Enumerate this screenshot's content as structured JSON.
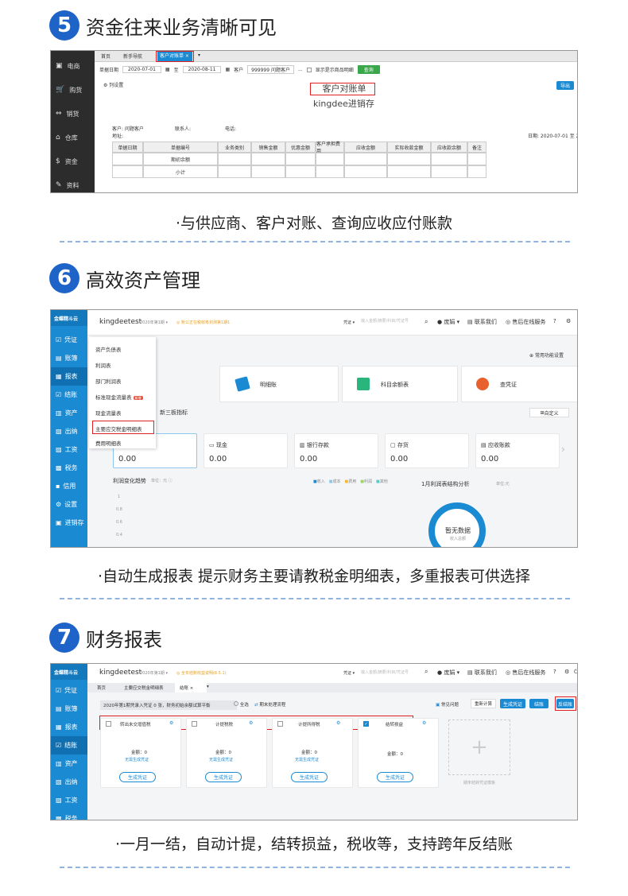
{
  "sections": [
    {
      "num": "5",
      "title": "资金往来业务清晰可见",
      "caption": "·与供应商、客户对账、查询应收应付账款"
    },
    {
      "num": "6",
      "title": "高效资产管理",
      "caption": "·自动生成报表 提示财务主要请教税金明细表，多重报表可供选择"
    },
    {
      "num": "7",
      "title": "财务报表",
      "caption": "·一月一结，自动计提，结转损益，税收等，支持跨年反结账"
    }
  ],
  "s1": {
    "sidebar": [
      {
        "icon": "▣",
        "label": "电商"
      },
      {
        "icon": "🛒",
        "label": "购货"
      },
      {
        "icon": "⇔",
        "label": "销货"
      },
      {
        "icon": "⌂",
        "label": "仓库"
      },
      {
        "icon": "$",
        "label": "资金"
      },
      {
        "icon": "✎",
        "label": "资料"
      }
    ],
    "tabs": [
      "首页",
      "新手导航",
      "客户对账单"
    ],
    "toolbar": {
      "date_label": "单据日期",
      "date_from": "2020-07-01",
      "to": "至",
      "date_to": "2020-08-11",
      "customer_label": "客户",
      "customer_value": "999999 问题客户",
      "more": "...",
      "checkbox_label": "显示是示商品明细",
      "query": "查询"
    },
    "settings": "列设置",
    "export": "导出",
    "report_title": "客户对账单",
    "report_sub": "kingdee进销存",
    "info": {
      "customer": "客户: 问题客户",
      "contact": "联系人:",
      "phone": "电话:",
      "address": "地址:",
      "date_range": "日期: 2020-07-01 至 2020"
    },
    "columns": [
      "单据日期",
      "单据编号",
      "业务类别",
      "销售金额",
      "优惠金额",
      "客户承担费用",
      "应收金额",
      "实际收款金额",
      "应收款余额",
      "备注"
    ],
    "rows": [
      "期初余额",
      "小计"
    ]
  },
  "s2": {
    "logo": "金蝶精斗云",
    "account": "kingdeetest",
    "period": "2020年第1期 ▾",
    "notice": "◎ 账公正在税收筹划测第1期1",
    "voucher": "凭证 ▾",
    "search_placeholder": "输入金额/摘要/科目/凭证号",
    "user": "庞娟 ▾",
    "contact": "联系我们",
    "service": "售后在线服务",
    "help": "?",
    "settings_icon": "⚙",
    "sidebar": [
      {
        "icon": "☑",
        "label": "凭证"
      },
      {
        "icon": "▤",
        "label": "账簿"
      },
      {
        "icon": "▦",
        "label": "报表"
      },
      {
        "icon": "☑",
        "label": "结账"
      },
      {
        "icon": "▥",
        "label": "资产"
      },
      {
        "icon": "▧",
        "label": "出纳"
      },
      {
        "icon": "▨",
        "label": "工资"
      },
      {
        "icon": "▩",
        "label": "税务"
      },
      {
        "icon": "▪",
        "label": "信用"
      },
      {
        "icon": "⚙",
        "label": "设置"
      },
      {
        "icon": "▣",
        "label": "进销存"
      }
    ],
    "menu": [
      "资产负债表",
      "利润表",
      "部门利润表",
      "标准现金流量表",
      "现金流量表",
      "主要应交税金明细表",
      "费用明细表"
    ],
    "menu_badge": "新增",
    "common": "常用功能设置",
    "shortcuts": [
      "明细账",
      "科目余额表",
      "查凭证"
    ],
    "tab_partial": "新三板指标",
    "customize": "自定义",
    "stats": [
      {
        "label": "",
        "value": "0.00"
      },
      {
        "label": "现金",
        "value": "0.00"
      },
      {
        "label": "银行存款",
        "value": "0.00"
      },
      {
        "label": "存货",
        "value": "0.00"
      },
      {
        "label": "应收账款",
        "value": "0.00"
      }
    ],
    "trend_title": "利润变化趋势",
    "trend_unit": "单位：元 ⓘ",
    "legend": [
      "收入",
      "成本",
      "费用",
      "利润",
      "其他"
    ],
    "y_ticks": [
      "1",
      "0.8",
      "0.6",
      "0.4"
    ],
    "struct_title": "1月利润表结构分析",
    "struct_unit": "单位:元",
    "no_data": "暂无数据",
    "no_data_sub": "收入总额",
    "colors": {
      "blue": "#1a8ad3",
      "red": "#e02020",
      "dark": "#2c2c2c"
    }
  },
  "s3": {
    "logo": "金蝶精斗云",
    "account": "kingdeetest",
    "period": "2020年第1期 ▾",
    "notice": "◎ 全年结账收益说明(8.5.1)",
    "voucher": "凭证 ▾",
    "search_placeholder": "输入金额/摘要/科目/凭证号",
    "user": "庞娟 ▾",
    "contact": "联系我们",
    "service": "售后在线服务",
    "sidebar": [
      {
        "icon": "☑",
        "label": "凭证"
      },
      {
        "icon": "▤",
        "label": "账簿"
      },
      {
        "icon": "▦",
        "label": "报表"
      },
      {
        "icon": "☑",
        "label": "结账"
      },
      {
        "icon": "▥",
        "label": "资产"
      },
      {
        "icon": "▧",
        "label": "出纳"
      },
      {
        "icon": "▨",
        "label": "工资"
      },
      {
        "icon": "▩",
        "label": "税务"
      }
    ],
    "tabs": [
      "首页",
      "主要应交税金明细表",
      "结账"
    ],
    "bar_text": "2020年第1期凭录入凭证 0 张，财务初始余额试算平衡",
    "all": "全选",
    "period_flow": "期末处理流程",
    "actions": [
      "常见问题",
      "重新计算",
      "生成凭证",
      "结账",
      "反结账"
    ],
    "cards": [
      {
        "title": "转出未交增值税",
        "amount": "金额：0",
        "link": "无需生成凭证",
        "btn": "生成凭证",
        "checked": false
      },
      {
        "title": "计提税税",
        "amount": "金额：0",
        "link": "无需生成凭证",
        "btn": "生成凭证",
        "checked": false
      },
      {
        "title": "计提所得税",
        "amount": "金额：0",
        "link": "无需生成凭证",
        "btn": "生成凭证",
        "checked": false
      },
      {
        "title": "结转损益",
        "amount": "金额：0",
        "link": "",
        "btn": "生成凭证",
        "checked": true
      }
    ],
    "add_label": "期末结转凭证模板"
  }
}
